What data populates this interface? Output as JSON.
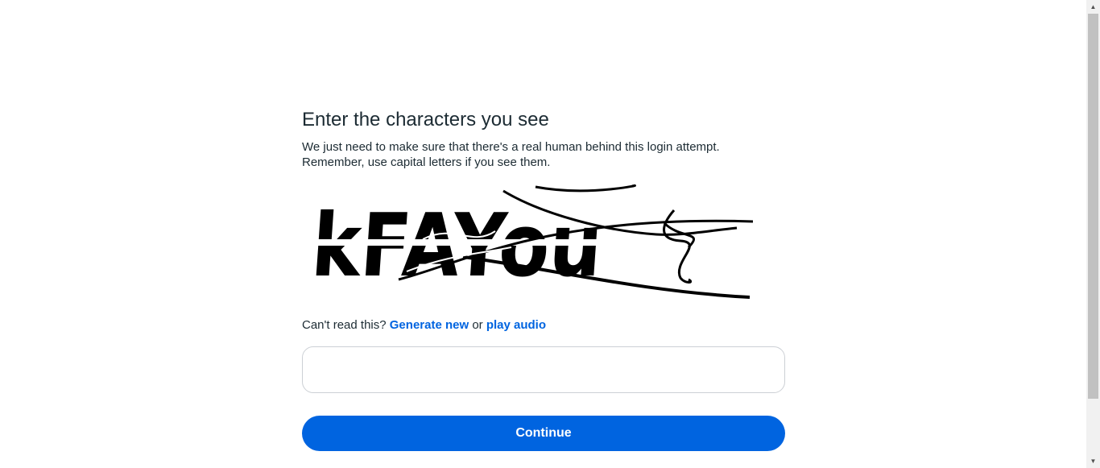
{
  "header": {
    "title": "Enter the characters you see",
    "description_line1": "We just need to make sure that there's a real human behind this login attempt.",
    "description_line2": "Remember, use capital letters if you see them."
  },
  "captcha": {
    "text": "kFAYou"
  },
  "help": {
    "prefix": "Can't read this?",
    "generate_new": "Generate new",
    "or": "or",
    "play_audio": "play audio"
  },
  "input": {
    "value": "",
    "placeholder": ""
  },
  "actions": {
    "continue_label": "Continue"
  },
  "colors": {
    "link": "#0064e0",
    "button": "#0064e0"
  },
  "scrollbar": {
    "up_icon": "triangle-up",
    "down_icon": "triangle-down"
  }
}
